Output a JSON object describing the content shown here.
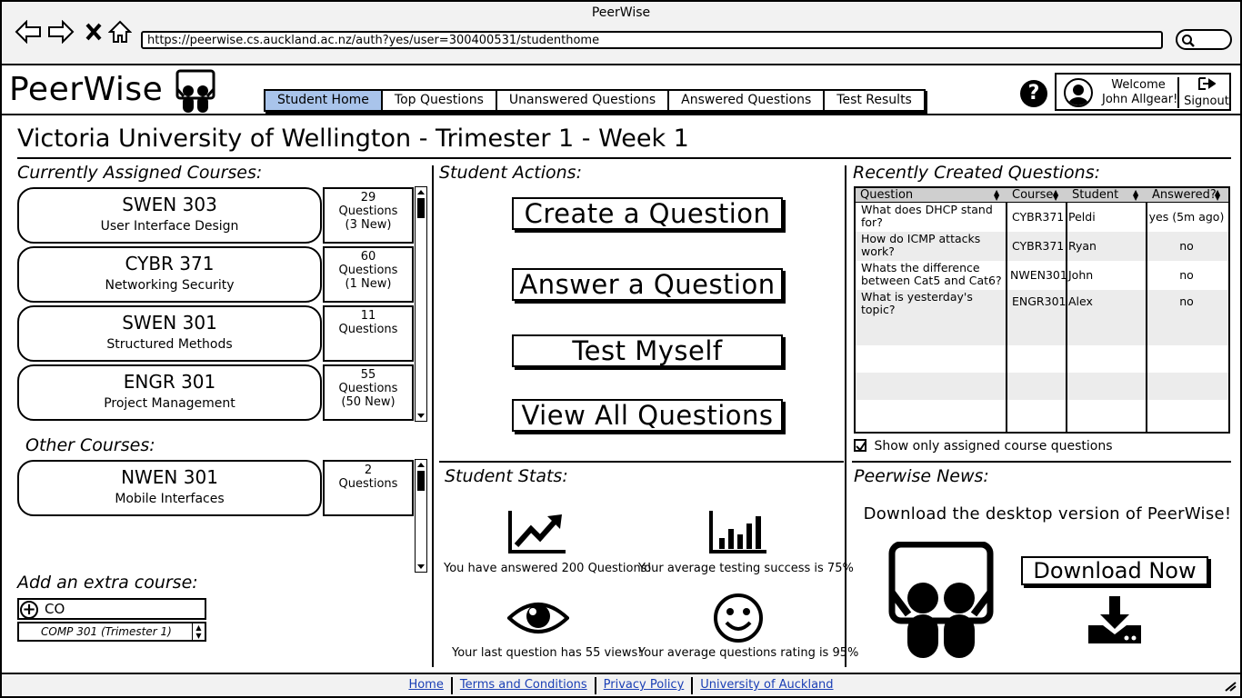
{
  "browser": {
    "window_title": "PeerWise",
    "url": "https://peerwise.cs.auckland.ac.nz/auth?yes/user=300400531/studenthome"
  },
  "header": {
    "logo_text": "PeerWise",
    "tabs": [
      {
        "label": "Student Home",
        "active": true
      },
      {
        "label": "Top Questions",
        "active": false
      },
      {
        "label": "Unanswered Questions",
        "active": false
      },
      {
        "label": "Answered Questions",
        "active": false
      },
      {
        "label": "Test Results",
        "active": false
      }
    ],
    "help": "?",
    "welcome_line1": "Welcome",
    "welcome_line2": "John Allgear!",
    "signout_label": "Signout"
  },
  "page_title": "Victoria University of Wellington - Trimester 1 - Week 1",
  "assigned": {
    "heading": "Currently Assigned Courses:",
    "courses": [
      {
        "code": "SWEN 303",
        "name": "User Interface Design",
        "count": "29",
        "count_label": "Questions",
        "new": "(3 New)"
      },
      {
        "code": "CYBR 371",
        "name": "Networking Security",
        "count": "60",
        "count_label": "Questions",
        "new": "(1 New)"
      },
      {
        "code": "SWEN 301",
        "name": "Structured Methods",
        "count": "11",
        "count_label": "Questions",
        "new": ""
      },
      {
        "code": "ENGR 301",
        "name": "Project Management",
        "count": "55",
        "count_label": "Questions",
        "new": "(50 New)"
      }
    ]
  },
  "other": {
    "heading": "Other Courses:",
    "courses": [
      {
        "code": "NWEN 301",
        "name": "Mobile Interfaces",
        "count": "2",
        "count_label": "Questions",
        "new": ""
      }
    ]
  },
  "add_course": {
    "heading": "Add an extra course:",
    "input_value": "CO",
    "suggestion": "COMP 301 (Trimester 1)"
  },
  "actions": {
    "heading": "Student Actions:",
    "buttons": [
      "Create a Question",
      "Answer a Question",
      "Test Myself",
      "View All Questions"
    ]
  },
  "stats": {
    "heading": "Student Stats:",
    "items": [
      {
        "icon": "trend-chart-icon",
        "text": "You have answered 200 Questions!"
      },
      {
        "icon": "bar-chart-icon",
        "text": "Your average testing success is 75%"
      },
      {
        "icon": "eye-icon",
        "text": "Your last question has 55 views!"
      },
      {
        "icon": "smiley-icon",
        "text": "Your average questions rating is 95%"
      }
    ]
  },
  "recent": {
    "heading": "Recently Created Questions:",
    "columns": [
      "Question",
      "Course",
      "Student",
      "Answered?"
    ],
    "rows": [
      {
        "question": "What does DHCP stand for?",
        "course": "CYBR371",
        "student": "Peldi",
        "answered": "yes (5m ago)"
      },
      {
        "question": "How do ICMP attacks work?",
        "course": "CYBR371",
        "student": "Ryan",
        "answered": "no"
      },
      {
        "question": "Whats the difference between Cat5 and Cat6?",
        "course": "NWEN301",
        "student": "John",
        "answered": "no"
      },
      {
        "question": "What is yesterday's topic?",
        "course": "ENGR301",
        "student": "Alex",
        "answered": "no"
      }
    ],
    "filter_label": "Show only assigned course questions",
    "filter_checked": true
  },
  "news": {
    "heading": "Peerwise News:",
    "text": "Download the desktop version of PeerWise!",
    "button": "Download Now"
  },
  "footer": {
    "links": [
      "Home",
      "Terms and Conditions",
      "Privacy Policy",
      "University of Auckland"
    ]
  }
}
